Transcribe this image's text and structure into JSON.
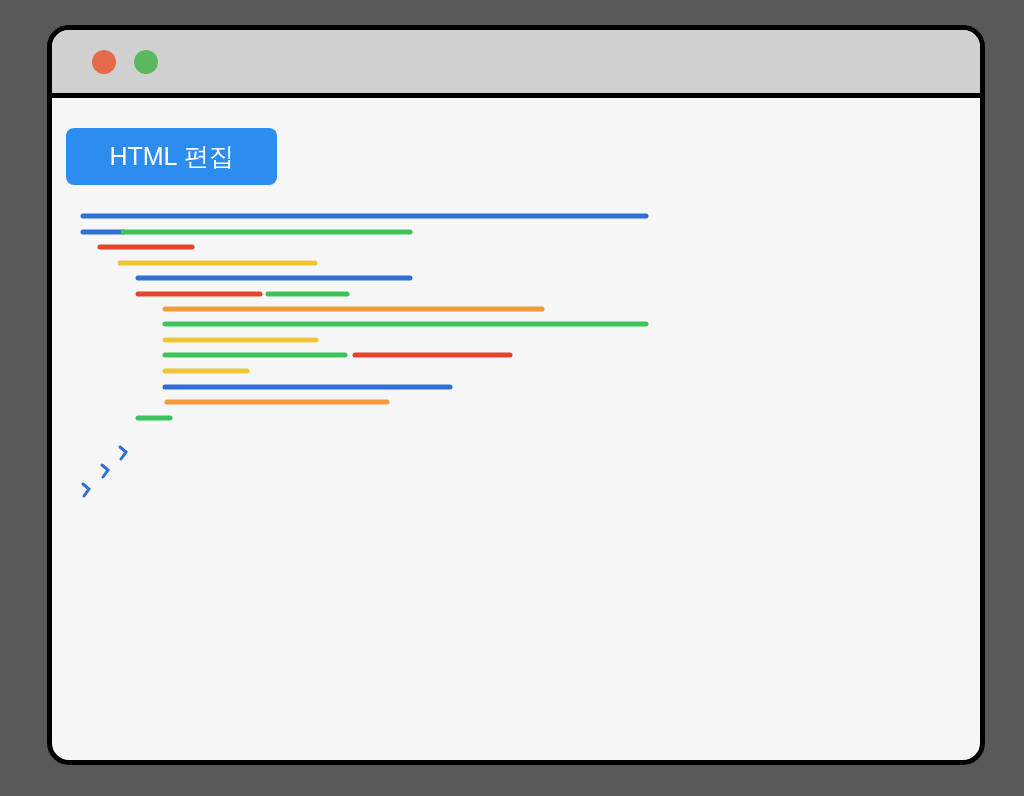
{
  "window": {
    "edit_button": {
      "label": "HTML 편집"
    }
  }
}
